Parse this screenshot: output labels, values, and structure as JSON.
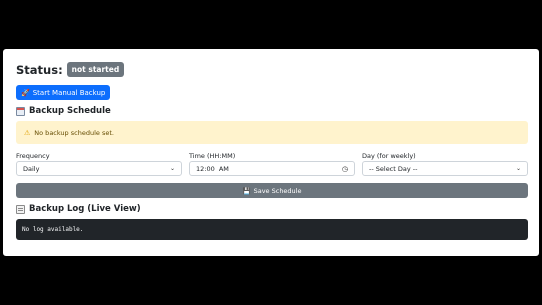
{
  "status": {
    "label": "Status:",
    "badge": "not started"
  },
  "manual_backup_button": "Start Manual Backup",
  "schedule": {
    "title": "Backup Schedule",
    "alert": "No backup schedule set.",
    "frequency": {
      "label": "Frequency",
      "value": "Daily"
    },
    "time": {
      "label": "Time (HH:MM)",
      "value": "12:00  AM"
    },
    "day": {
      "label": "Day (for weekly)",
      "value": "-- Select Day --"
    },
    "save_button": "Save Schedule"
  },
  "log": {
    "title": "Backup Log (Live View)",
    "content": "No log available."
  },
  "icons": {
    "manual_backup": "rocket-icon",
    "schedule": "calendar-icon",
    "alert": "warning-icon",
    "time": "clock-icon",
    "save": "floppy-disk-icon",
    "log": "clipboard-icon"
  },
  "colors": {
    "primary": "#0d6efd",
    "secondary": "#6c757d",
    "alert_bg": "#fff3cd",
    "log_bg": "#212529"
  }
}
